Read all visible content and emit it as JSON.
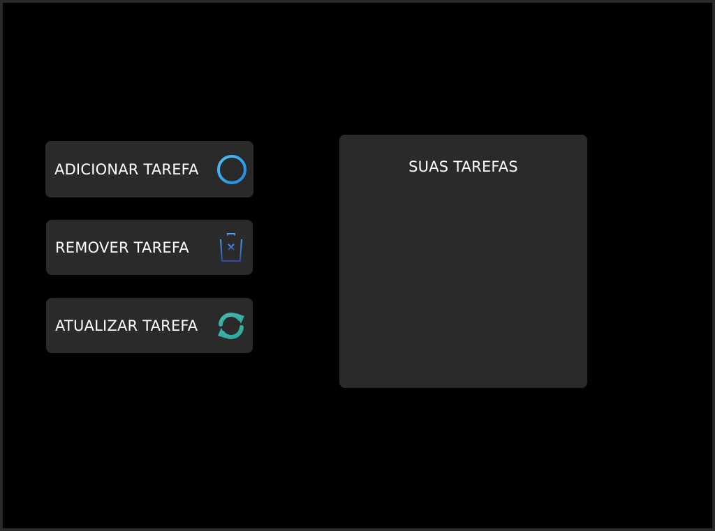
{
  "actions": {
    "add": {
      "label": "ADICIONAR TAREFA",
      "icon": "plus-circle-icon",
      "color": "#29b6f6"
    },
    "remove": {
      "label": "REMOVER TAREFA",
      "icon": "trash-icon",
      "color": "#3f51b5"
    },
    "update": {
      "label": "ATUALIZAR TAREFA",
      "icon": "refresh-icon",
      "color": "#26a69a"
    }
  },
  "tasks_panel": {
    "title": "SUAS TAREFAS"
  },
  "colors": {
    "background": "#000000",
    "surface": "#2a2a2a",
    "text": "#ffffff"
  }
}
